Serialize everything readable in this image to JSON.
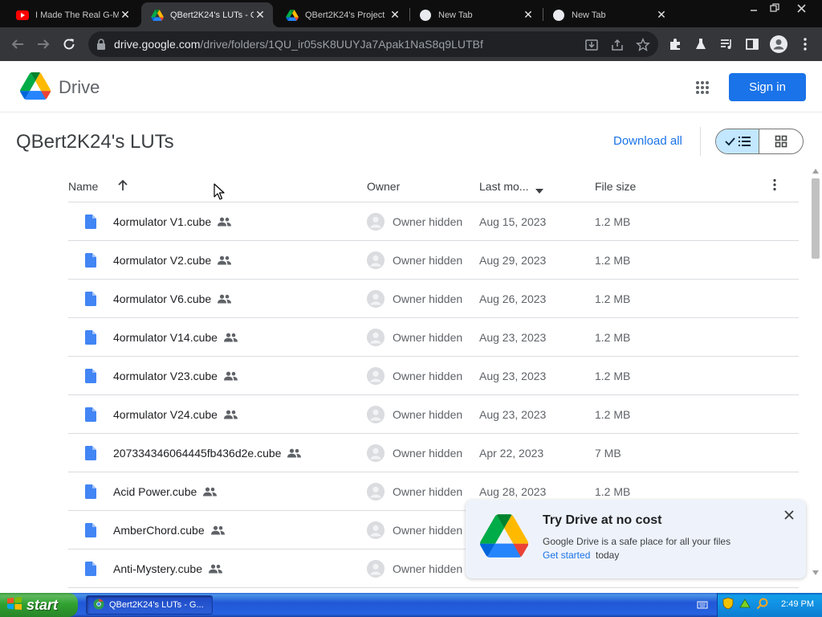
{
  "browser": {
    "tabs": [
      {
        "title": "I Made The Real G-M",
        "favicon": "youtube-icon",
        "active": false
      },
      {
        "title": "QBert2K24's LUTs - G",
        "favicon": "google-drive-icon",
        "active": true
      },
      {
        "title": "QBert2K24's Project",
        "favicon": "google-drive-icon",
        "active": false
      },
      {
        "title": "New Tab",
        "favicon": "chrome-newtab-icon",
        "active": false
      },
      {
        "title": "New Tab",
        "favicon": "chrome-newtab-icon",
        "active": false
      }
    ],
    "url_host": "drive.google.com",
    "url_path": "/drive/folders/1QU_ir05sK8UUYJa7Apak1NaS8q9LUTBf"
  },
  "drive": {
    "app_name": "Drive",
    "sign_in_label": "Sign in",
    "folder_title": "QBert2K24's LUTs",
    "download_all_label": "Download all",
    "accent_color": "#1a73e8"
  },
  "table": {
    "columns": {
      "name": "Name",
      "owner": "Owner",
      "modified": "Last mo...",
      "size": "File size"
    },
    "rows": [
      {
        "name": "4ormulator V1.cube",
        "owner": "Owner hidden",
        "modified": "Aug 15, 2023",
        "size": "1.2 MB"
      },
      {
        "name": "4ormulator V2.cube",
        "owner": "Owner hidden",
        "modified": "Aug 29, 2023",
        "size": "1.2 MB"
      },
      {
        "name": "4ormulator V6.cube",
        "owner": "Owner hidden",
        "modified": "Aug 26, 2023",
        "size": "1.2 MB"
      },
      {
        "name": "4ormulator V14.cube",
        "owner": "Owner hidden",
        "modified": "Aug 23, 2023",
        "size": "1.2 MB"
      },
      {
        "name": "4ormulator V23.cube",
        "owner": "Owner hidden",
        "modified": "Aug 23, 2023",
        "size": "1.2 MB"
      },
      {
        "name": "4ormulator V24.cube",
        "owner": "Owner hidden",
        "modified": "Aug 23, 2023",
        "size": "1.2 MB"
      },
      {
        "name": "207334346064445fb436d2e.cube",
        "owner": "Owner hidden",
        "modified": "Apr 22, 2023",
        "size": "7 MB"
      },
      {
        "name": "Acid Power.cube",
        "owner": "Owner hidden",
        "modified": "Aug 28, 2023",
        "size": "1.2 MB"
      },
      {
        "name": "AmberChord.cube",
        "owner": "Owner hidden",
        "modified": "",
        "size": ""
      },
      {
        "name": "Anti-Mystery.cube",
        "owner": "Owner hidden",
        "modified": "",
        "size": ""
      }
    ]
  },
  "promo": {
    "title": "Try Drive at no cost",
    "description": "Google Drive is a safe place for all your files",
    "link_label": "Get started",
    "link_tail": "today"
  },
  "taskbar": {
    "start_label": "start",
    "task_item_label": "QBert2K24's LUTs - G...",
    "clock": "2:49 PM"
  }
}
